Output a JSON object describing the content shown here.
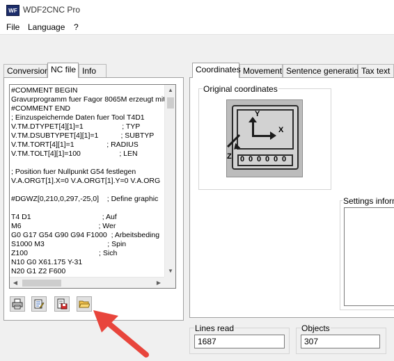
{
  "window": {
    "icon_text": "WF",
    "title": "WDF2CNC Pro"
  },
  "menu": {
    "file": "File",
    "language": "Language",
    "help": "?"
  },
  "left_tabs": [
    "Conversion",
    "NC file",
    "Info"
  ],
  "right_tabs": [
    "Coordinates",
    "Movement",
    "Sentence generation",
    "Tax text"
  ],
  "nc_file": {
    "lines": [
      "#COMMENT BEGIN",
      "Gravurprogramm fuer Fagor 8065M erzeugt mit",
      "#COMMENT END",
      "; Einzuspeichernde Daten fuer Tool T4D1",
      "V.TM.DTYPET[4][1]=1                   ; TYP",
      "V.TM.DSUBTYPET[4][1]=1           ; SUBTYP",
      "V.TM.TORT[4][1]=1                ; RADIUS",
      "V.TM.TOLT[4][1]=100                   ; LEN",
      "",
      "; Position fuer Nullpunkt G54 festlegen",
      "V.A.ORGT[1].X=0 V.A.ORGT[1].Y=0 V.A.ORG",
      "",
      "#DGWZ[0,210,0,297,-25,0]    ; Define graphic",
      "",
      "T4 D1                                   ; Auf",
      "M6                                      ; Wer",
      "G0 G17 G54 G90 G94 F1000  ; Arbeitsbeding",
      "S1000 M3                               ; Spin",
      "Z100                                   ; Sich",
      "N10 G0 X61.175 Y-31",
      "N20 G1 Z2 F600"
    ]
  },
  "coordinates": {
    "group_title": "Original coordinates",
    "axis_labels": {
      "y": "Y",
      "x": "X",
      "z": "Z"
    },
    "display_digits": [
      "0",
      "0",
      "0",
      "0",
      "0",
      "0"
    ]
  },
  "settings": {
    "label": "Settings informa"
  },
  "lines_read": {
    "label": "Lines read",
    "value": "1687"
  },
  "objects": {
    "label": "Objects",
    "value": "307"
  },
  "colors": {
    "annotation_arrow": "#e8453c",
    "screen_dark": "#2b2b2b",
    "screen_light": "#d2d2d2"
  }
}
